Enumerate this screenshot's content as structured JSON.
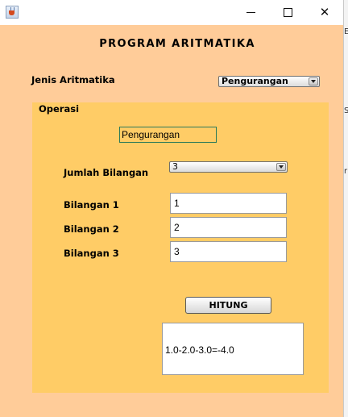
{
  "window": {
    "title": "",
    "background_color": "#ffcc99",
    "panel_color": "#ffcc66",
    "icons": {
      "app": "java-cup-icon",
      "minimize": "minimize-icon",
      "maximize": "maximize-icon",
      "close": "close-icon"
    },
    "close_glyph": "✕"
  },
  "main": {
    "title": "PROGRAM ARITMATIKA",
    "jenis_label": "Jenis Aritmatika",
    "jenis_selected": "Pengurangan"
  },
  "operasi": {
    "label": "Operasi",
    "operation_field": "Pengurangan",
    "jumlah_label": "Jumlah Bilangan",
    "jumlah_selected": "3",
    "bilangan1_label": "Bilangan 1",
    "bilangan1_value": "1",
    "bilangan2_label": "Bilangan 2",
    "bilangan2_value": "2",
    "bilangan3_label": "Bilangan 3",
    "bilangan3_value": "3",
    "hitung_label": "HITUNG",
    "result": "1.0-2.0-3.0=-4.0"
  },
  "background_window": {
    "letters": [
      "E",
      "S",
      "r"
    ]
  }
}
